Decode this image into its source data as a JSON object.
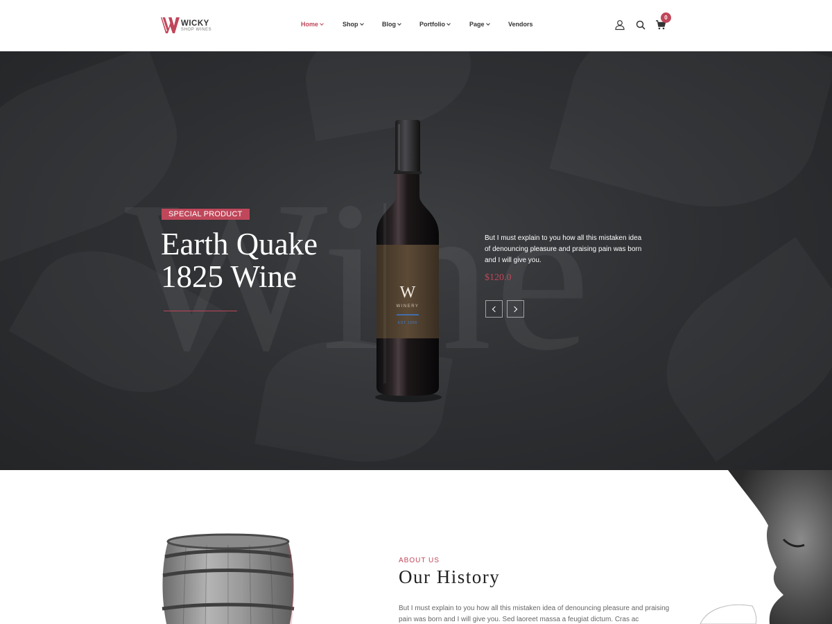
{
  "header": {
    "logo": {
      "name": "WICKY",
      "tagline": "SHOP WINES",
      "mark_color": "#c0475a"
    },
    "nav": [
      {
        "label": "Home",
        "active": true,
        "has_dropdown": true
      },
      {
        "label": "Shop",
        "active": false,
        "has_dropdown": true
      },
      {
        "label": "Blog",
        "active": false,
        "has_dropdown": true
      },
      {
        "label": "Portfolio",
        "active": false,
        "has_dropdown": true
      },
      {
        "label": "Page",
        "active": false,
        "has_dropdown": true
      },
      {
        "label": "Vendors",
        "active": false,
        "has_dropdown": false
      }
    ],
    "icons": [
      "user-icon",
      "search-icon",
      "cart-icon"
    ],
    "cart_count": "0"
  },
  "hero": {
    "watermark": "Wine",
    "tag": "SPECIAL PRODUCT",
    "title_line1": "Earth Quake",
    "title_line2": "1825 Wine",
    "description": "But I must explain to you how all this mistaken idea of denouncing pleasure and praising pain was born and I will give you.",
    "price": "$120.0",
    "bottle_label": {
      "initial": "W",
      "brand": "WINERY",
      "est": "EST 1985"
    }
  },
  "about": {
    "label": "ABOUT US",
    "title": "Our History",
    "text": "But I must explain to you how all this mistaken idea of denouncing pleasure and praising pain was born and I will give you. Sed laoreet massa a feugiat dictum. Cras ac"
  },
  "colors": {
    "accent": "#c0475a",
    "hero_bg": "#2e3033",
    "text_dark": "#222222"
  }
}
